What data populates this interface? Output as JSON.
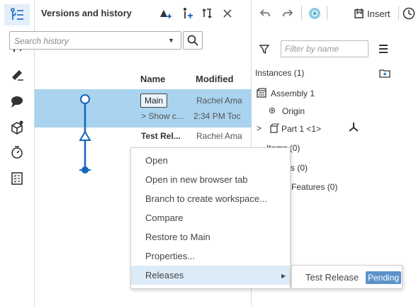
{
  "panel": {
    "title": "Versions and history",
    "search_placeholder": "Search history",
    "col_name": "Name",
    "col_modified": "Modified"
  },
  "rows": [
    {
      "name": "Main",
      "modified": "Rachel Ama",
      "sub_name": "> Show c...",
      "sub_modified": "2:34 PM Toc",
      "selected": true
    },
    {
      "name": "Test Rel...",
      "modified": "Rachel Ama",
      "selected": false
    }
  ],
  "toolbar": {
    "insert_label": "Insert"
  },
  "instances": {
    "filter_placeholder": "Filter by name",
    "header": "Instances (1)",
    "assembly": "Assembly 1",
    "origin": "Origin",
    "part": "Part 1 <1>",
    "items_partial": "Items (0)",
    "s_partial": "s (0)",
    "features_partial": "Features (0)"
  },
  "context_menu": {
    "items": [
      "Open",
      "Open in new browser tab",
      "Branch to create workspace...",
      "Compare",
      "Restore to Main",
      "Properties...",
      "Releases"
    ],
    "highlighted_index": 6
  },
  "submenu": {
    "label": "Test Release",
    "badge": "Pending"
  },
  "colors": {
    "selection": "#a9d3ee",
    "accent_blue": "#1565c0",
    "menu_highlight": "#dcebf8",
    "pending_badge": "#5b93c9"
  },
  "icons": {
    "rail": [
      "version-history-icon",
      "insert-variable-icon",
      "pen-icon",
      "comment-icon",
      "material-icon",
      "timer-icon",
      "checklist-icon"
    ],
    "header": [
      "create-release-icon",
      "create-version-icon",
      "branch-compare-icon",
      "close-icon"
    ]
  }
}
